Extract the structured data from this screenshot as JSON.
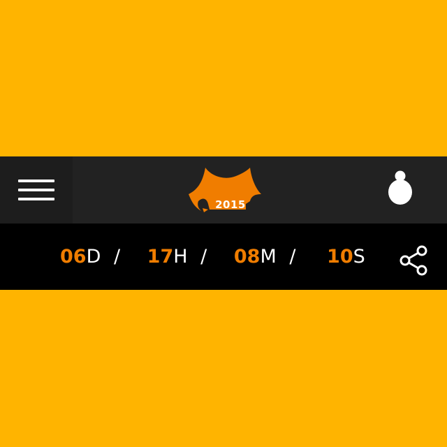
{
  "colors": {
    "background": "#FFB400",
    "navbar": "#222222",
    "countdown_bar": "#000000",
    "accent": "#F07D00",
    "text": "#FFFFFF"
  },
  "header": {
    "menu_icon": "hamburger-menu-icon",
    "logo": {
      "icon": "tent-logo-icon",
      "year": "2015"
    },
    "user_icon": "user-icon"
  },
  "countdown": {
    "days": {
      "value": "06",
      "unit": "D"
    },
    "hours": {
      "value": "17",
      "unit": "H"
    },
    "minutes": {
      "value": "08",
      "unit": "M"
    },
    "seconds": {
      "value": "10",
      "unit": "S"
    },
    "separator": "/"
  },
  "share": {
    "icon": "share-icon"
  }
}
